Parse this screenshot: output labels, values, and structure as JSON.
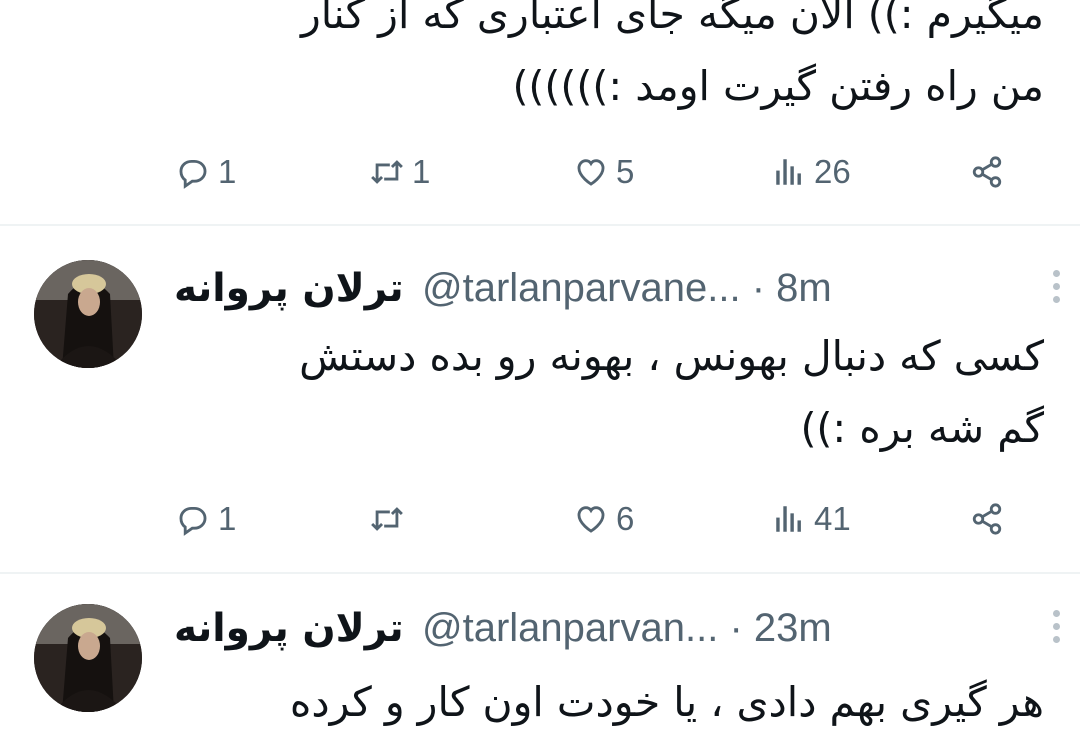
{
  "tweets": [
    {
      "text_lines": [
        "میگیرم :)) الان میگه جای اعتباری که از کنار",
        "من راه رفتن گیرت اومد :))))))"
      ],
      "replies": "1",
      "retweets": "1",
      "likes": "5",
      "views": "26"
    },
    {
      "name": "ترلان پروانه",
      "handle": "@tarlanparvane...",
      "time": "· 8m",
      "text_lines": [
        "کسی که دنبال بهونس ، بهونه رو بده دستش",
        "گم شه بره :))"
      ],
      "replies": "1",
      "retweets": "",
      "likes": "6",
      "views": "41"
    },
    {
      "name": "ترلان پروانه",
      "handle": "@tarlanparvan...",
      "time": "· 23m",
      "text_lines": [
        "هر گیری بهم دادی ، یا خودت اون کار و کرده"
      ]
    }
  ],
  "icons": {
    "reply": "reply-icon",
    "retweet": "retweet-icon",
    "like": "like-icon",
    "views": "views-icon",
    "share": "share-icon",
    "more": "more-options-icon"
  },
  "colors": {
    "text": "#0f1419",
    "secondary": "#536471",
    "divider": "#eff3f4"
  }
}
